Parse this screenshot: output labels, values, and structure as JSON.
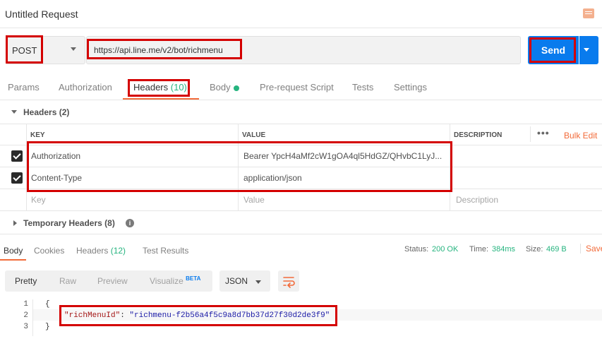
{
  "title_bar": {
    "title": "Untitled Request",
    "comment_icon": "comment-icon"
  },
  "request": {
    "method": "POST",
    "url": "https://api.line.me/v2/bot/richmenu",
    "send_label": "Send"
  },
  "request_tabs": [
    {
      "label": "Params"
    },
    {
      "label": "Authorization"
    },
    {
      "label": "Headers",
      "count": "(10)"
    },
    {
      "label": "Body"
    },
    {
      "label": "Pre-request Script"
    },
    {
      "label": "Tests"
    },
    {
      "label": "Settings"
    }
  ],
  "headers_section": {
    "title": "Headers (2)",
    "columns": {
      "key": "KEY",
      "value": "VALUE",
      "description": "DESCRIPTION"
    },
    "more": "•••",
    "bulk_edit": "Bulk Edit",
    "rows": [
      {
        "checked": true,
        "key": "Authorization",
        "value": "Bearer YpcH4aMf2cW1gOA4ql5HdGZ/QHvbC1LyJ..."
      },
      {
        "checked": true,
        "key": "Content-Type",
        "value": "application/json"
      }
    ],
    "placeholder": {
      "key": "Key",
      "value": "Value",
      "description": "Description"
    }
  },
  "temporary_headers": {
    "title": "Temporary Headers (8)",
    "info": "i"
  },
  "response_tabs": [
    {
      "label": "Body"
    },
    {
      "label": "Cookies"
    },
    {
      "label": "Headers",
      "count": "(12)"
    },
    {
      "label": "Test Results"
    }
  ],
  "response_status": {
    "status_label": "Status:",
    "status_value": "200 OK",
    "time_label": "Time:",
    "time_value": "384ms",
    "size_label": "Size:",
    "size_value": "469 B",
    "save_label": "Save"
  },
  "response_view": {
    "modes": [
      "Pretty",
      "Raw",
      "Preview",
      "Visualize"
    ],
    "beta": "BETA",
    "format": "JSON"
  },
  "response_body": {
    "line_numbers": [
      "1",
      "2",
      "3"
    ],
    "open_brace": "{",
    "key": "\"richMenuId\"",
    "colon": ": ",
    "value": "\"richmenu-f2b56a4f5c9a8d7bb37d27f30d2de3f9\"",
    "close_brace": "}"
  },
  "colors": {
    "accent": "#f26b3a",
    "send": "#097bed",
    "success": "#26b47f",
    "highlight": "#d40000"
  }
}
